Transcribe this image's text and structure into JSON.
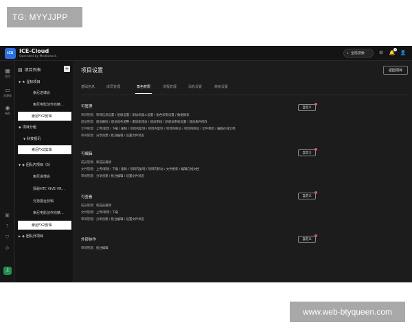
{
  "watermarks": {
    "top": "TG: MYYJJPP",
    "bottom": "www.web-btyqueen.com"
  },
  "brand": {
    "logo": "ICE",
    "name": "ICE-Cloud",
    "sub": "Operated by Mediatrack"
  },
  "topbar": {
    "search_label": "全局搜索",
    "notif_count": "1"
  },
  "rail": {
    "items": [
      {
        "label": "项目",
        "icon": "grid-icon"
      },
      {
        "label": "资源库",
        "icon": "folder-icon"
      },
      {
        "label": "待办",
        "icon": "task-icon"
      }
    ],
    "avatar": "上"
  },
  "tree": {
    "header": "项目列表",
    "nodes": [
      {
        "label": "星标项目",
        "type": "folder"
      },
      {
        "label": "索尼进博会",
        "type": "item"
      },
      {
        "label": "索尼电影创作坊精...",
        "type": "item"
      },
      {
        "label": "索尼FX2剪辑",
        "type": "item"
      },
      {
        "label": "项目分组",
        "type": "folder"
      },
      {
        "label": "科技视讯",
        "type": "folder"
      },
      {
        "label": "索尼FX2剪辑",
        "type": "item"
      },
      {
        "label": "团队内项目（5）",
        "type": "folder"
      },
      {
        "label": "索尼进博会",
        "type": "item"
      },
      {
        "label": "探秘HTC VIVE VR...",
        "type": "item"
      },
      {
        "label": "兄弟展台剪辑",
        "type": "item"
      },
      {
        "label": "索尼电影创作坊精...",
        "type": "item"
      },
      {
        "label": "索尼FX2剪辑",
        "type": "item"
      },
      {
        "label": "团队外项目",
        "type": "folder"
      }
    ]
  },
  "main": {
    "title": "项目设置",
    "back_label": "返回项目",
    "tabs": [
      "基础信息",
      "成员管理",
      "角色权限",
      "流程管理",
      "消息设置",
      "高级设置"
    ],
    "active_tab": "角色权限",
    "custom_label": "自定义",
    "sections": [
      {
        "title": "可管理",
        "rows": [
          {
            "k": "项目管理：",
            "v": "项目信息设置 / 层级设置 / 添加机器人设置 / 角色权限设置 / 数据报表"
          },
          {
            "k": "成员管理：",
            "v": "成员删除 / 成员角色调整 / 邀请新成员 / 成员审核 / 新成员审核设置 / 成员离开修改"
          },
          {
            "k": "文件管理：",
            "v": "上传/新建 / 下载 / 删除 / 项目内复制 / 项目内复制 / 项目内移动 / 项目内移动 / 文件更新 / 编辑在线文档"
          },
          {
            "k": "审阅管理：",
            "v": "分享创建 / 批注编辑 / 设置文件状态"
          }
        ]
      },
      {
        "title": "可编辑",
        "rows": [
          {
            "k": "成员管理：",
            "v": "新成员邀请"
          },
          {
            "k": "文件管理：",
            "v": "上传/新建 / 下载 / 删除 / 项目内复制 / 项目内移动 / 文件更新 / 编辑在线文档"
          },
          {
            "k": "审阅管理：",
            "v": "分享创建 / 批注编辑 / 设置文件状态"
          }
        ]
      },
      {
        "title": "可查看",
        "rows": [
          {
            "k": "成员管理：",
            "v": "新成员邀请"
          },
          {
            "k": "文件管理：",
            "v": "上传/新建 / 下载"
          },
          {
            "k": "审阅管理：",
            "v": "分享创建 / 批注编辑 / 设置文件状态"
          }
        ]
      },
      {
        "title": "外部协作",
        "rows": [
          {
            "k": "审阅管理：",
            "v": "批注编辑"
          }
        ]
      }
    ]
  }
}
